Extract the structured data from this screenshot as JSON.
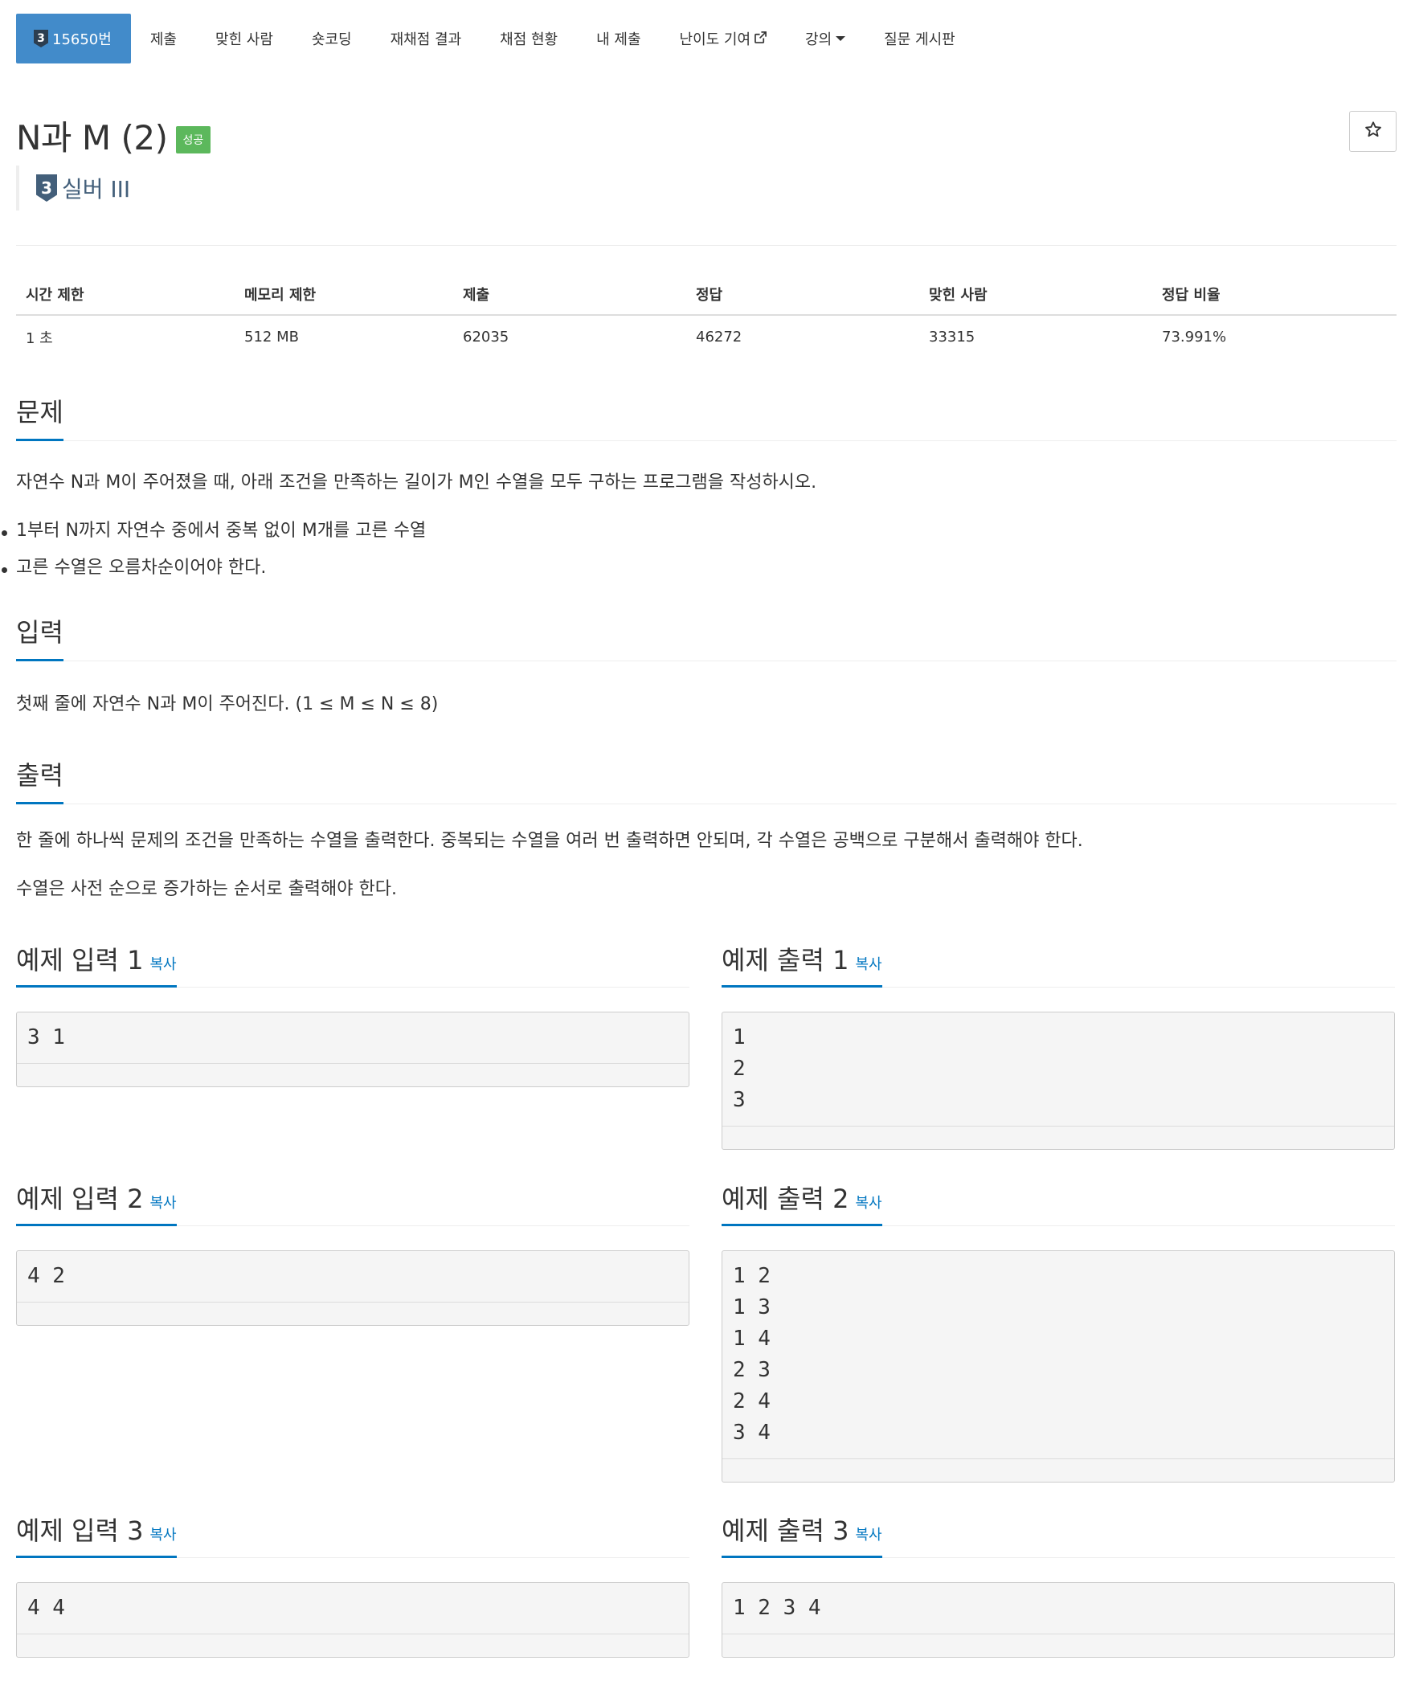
{
  "nav": {
    "items": [
      {
        "label": "15650번",
        "tier": "3",
        "active": true
      },
      {
        "label": "제출"
      },
      {
        "label": "맞힌 사람"
      },
      {
        "label": "숏코딩"
      },
      {
        "label": "재채점 결과"
      },
      {
        "label": "채점 현황"
      },
      {
        "label": "내 제출"
      },
      {
        "label": "난이도 기여"
      },
      {
        "label": "강의"
      },
      {
        "label": "질문 게시판"
      }
    ]
  },
  "problem": {
    "title": "N과 M (2)",
    "badge": "성공",
    "tier_number": "3",
    "tier_label": "실버 III"
  },
  "info": {
    "headers": [
      "시간 제한",
      "메모리 제한",
      "제출",
      "정답",
      "맞힌 사람",
      "정답 비율"
    ],
    "values": [
      "1 초",
      "512 MB",
      "62035",
      "46272",
      "33315",
      "73.991%"
    ]
  },
  "sections": {
    "description_title": "문제",
    "description": "자연수 N과 M이 주어졌을 때, 아래 조건을 만족하는 길이가 M인 수열을 모두 구하는 프로그램을 작성하시오.",
    "conditions": [
      "1부터 N까지 자연수 중에서 중복 없이 M개를 고른 수열",
      "고른 수열은 오름차순이어야 한다."
    ],
    "input_title": "입력",
    "input": "첫째 줄에 자연수 N과 M이 주어진다. (1 ≤ M ≤ N ≤ 8)",
    "output_title": "출력",
    "output_1": "한 줄에 하나씩 문제의 조건을 만족하는 수열을 출력한다. 중복되는 수열을 여러 번 출력하면 안되며, 각 수열은 공백으로 구분해서 출력해야 한다.",
    "output_2": "수열은 사전 순으로 증가하는 순서로 출력해야 한다."
  },
  "samples": {
    "copy_label": "복사",
    "in1_title": "예제 입력 1",
    "in1": "3 1",
    "out1_title": "예제 출력 1",
    "out1": "1\n2\n3",
    "in2_title": "예제 입력 2",
    "in2": "4 2",
    "out2_title": "예제 출력 2",
    "out2": "1 2\n1 3\n1 4\n2 3\n2 4\n3 4",
    "in3_title": "예제 입력 3",
    "in3": "4 4",
    "out3_title": "예제 출력 3",
    "out3": "1 2 3 4"
  },
  "colors": {
    "active_nav": "#428bca",
    "success": "#5cb85c",
    "accent": "#0076c0",
    "tier_silver": "#435f7a"
  },
  "icons": {
    "star": "star-outline-icon",
    "external": "external-link-icon",
    "dropdown": "caret-down-icon"
  }
}
